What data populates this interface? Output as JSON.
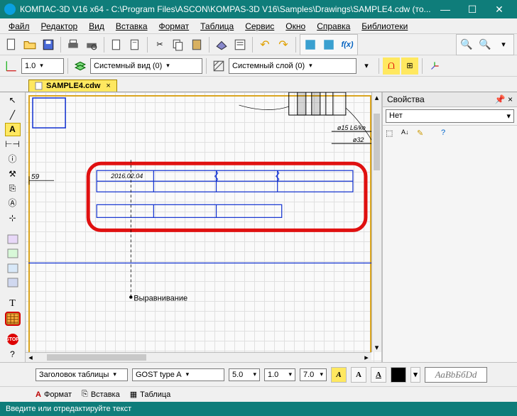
{
  "titlebar": {
    "title": "КОМПАС-3D V16  x64 - C:\\Program Files\\ASCON\\KOMPAS-3D V16\\Samples\\Drawings\\SAMPLE4.cdw (то..."
  },
  "menubar": {
    "items": [
      "Файл",
      "Редактор",
      "Вид",
      "Вставка",
      "Формат",
      "Таблица",
      "Сервис",
      "Окно",
      "Справка",
      "Библиотеки"
    ]
  },
  "toolbar2": {
    "scale": "1.0",
    "view_dd": "Системный вид (0)",
    "layer_dd": "Системный слой (0)"
  },
  "doctab": {
    "label": "SAMPLE4.cdw"
  },
  "canvas": {
    "dim_label_1": "59",
    "table_cell_1": "2016.02.04",
    "note_1": "Выравнивание",
    "dim_small_1": "ø15 L6/ke",
    "dim_small_2": "ø32"
  },
  "rightpanel": {
    "title": "Свойства",
    "filter": "Нет"
  },
  "propbar": {
    "section_dd": "Заголовок таблицы",
    "font_dd": "GOST type A",
    "size": "5.0",
    "spacing": "1.0",
    "height": "7.0",
    "preview": "АаВbБбDd"
  },
  "tabs2": {
    "format": "Формат",
    "insert": "Вставка",
    "table": "Таблица"
  },
  "statusbar": {
    "text": "Введите или отредактируйте текст"
  }
}
